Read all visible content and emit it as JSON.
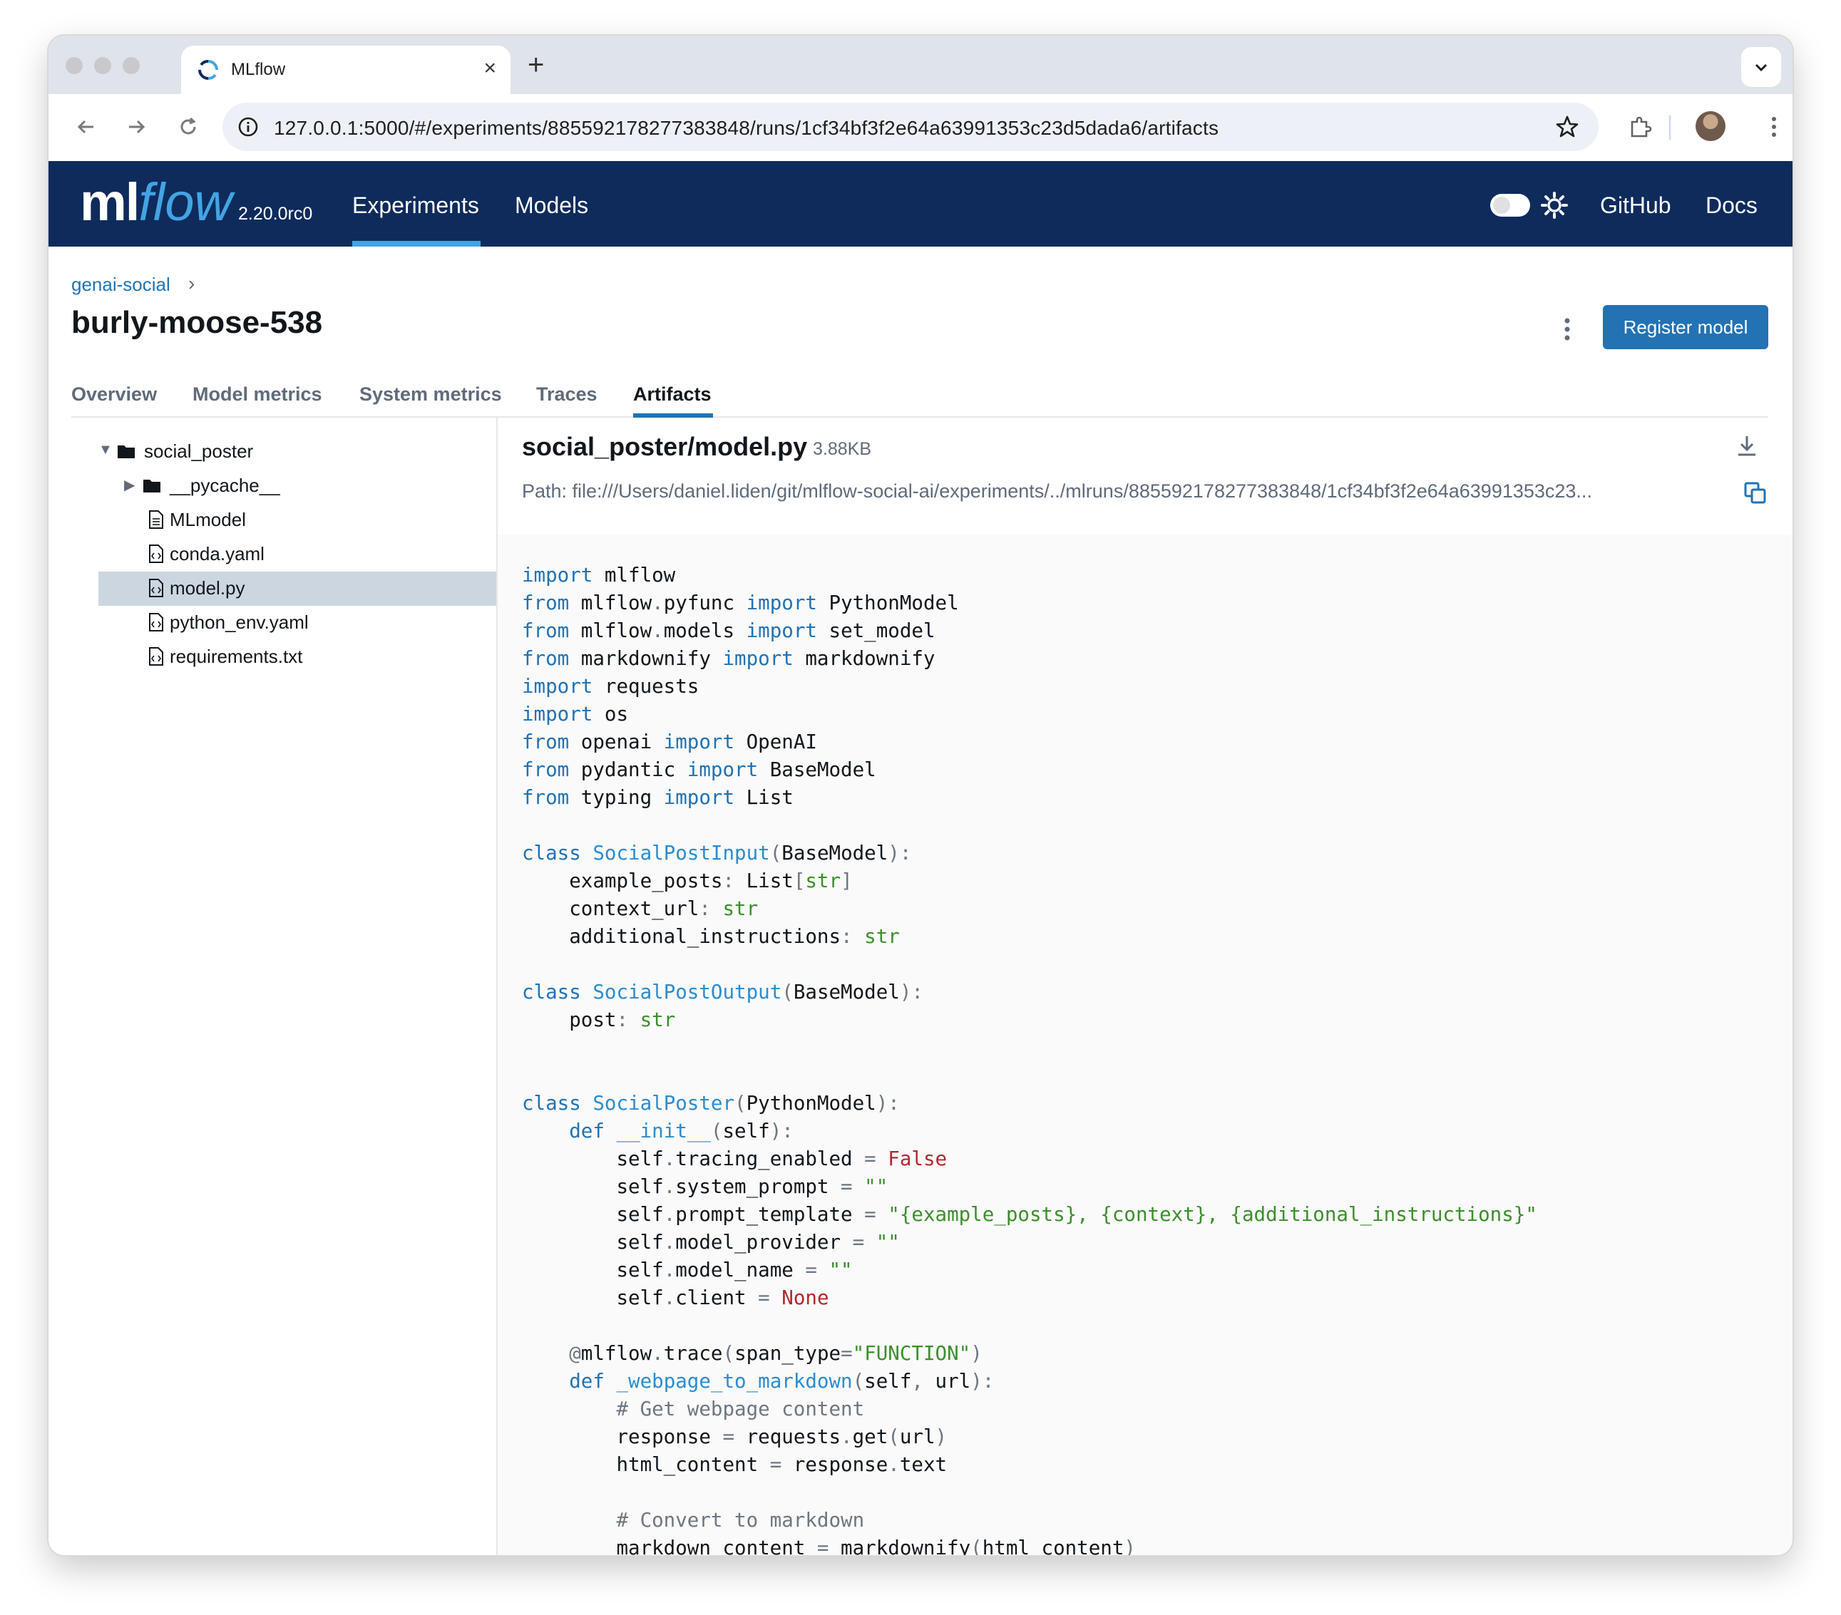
{
  "browser": {
    "tab_title": "MLflow",
    "tab_close": "×",
    "new_tab": "+",
    "url": "127.0.0.1:5000/#/experiments/885592178277383848/runs/1cf34bf3f2e64a63991353c23d5dada6/artifacts"
  },
  "header": {
    "logo_ml": "ml",
    "logo_flow": "flow",
    "version": "2.20.0rc0",
    "nav": [
      "Experiments",
      "Models"
    ],
    "right_links": [
      "GitHub",
      "Docs"
    ]
  },
  "run": {
    "breadcrumb": "genai-social",
    "breadcrumb_sep": "›",
    "title": "burly-moose-538",
    "register_label": "Register model",
    "tabs": [
      "Overview",
      "Model metrics",
      "System metrics",
      "Traces",
      "Artifacts"
    ],
    "active_tab": "Artifacts"
  },
  "tree": {
    "items": [
      {
        "label": "social_poster",
        "type": "folder",
        "caret": "▼"
      },
      {
        "label": "__pycache__",
        "type": "folder",
        "caret": "▶"
      },
      {
        "label": "MLmodel",
        "type": "file"
      },
      {
        "label": "conda.yaml",
        "type": "code-file"
      },
      {
        "label": "model.py",
        "type": "code-file",
        "selected": true
      },
      {
        "label": "python_env.yaml",
        "type": "code-file"
      },
      {
        "label": "requirements.txt",
        "type": "code-file"
      }
    ]
  },
  "file": {
    "name": "social_poster/model.py",
    "size": "3.88KB",
    "path": "Path: file:///Users/daniel.liden/git/mlflow-social-ai/experiments/../mlruns/885592178277383848/1cf34bf3f2e64a63991353c23..."
  },
  "code": [
    "import mlflow",
    "from mlflow.pyfunc import PythonModel",
    "from mlflow.models import set_model",
    "from markdownify import markdownify",
    "import requests",
    "import os",
    "from openai import OpenAI",
    "from pydantic import BaseModel",
    "from typing import List",
    "",
    "class SocialPostInput(BaseModel):",
    "    example_posts: List[str]",
    "    context_url: str",
    "    additional_instructions: str",
    "",
    "class SocialPostOutput(BaseModel):",
    "    post: str",
    "",
    "",
    "class SocialPoster(PythonModel):",
    "    def __init__(self):",
    "        self.tracing_enabled = False",
    "        self.system_prompt = \"\"",
    "        self.prompt_template = \"{example_posts}, {context}, {additional_instructions}\"",
    "        self.model_provider = \"\"",
    "        self.model_name = \"\"",
    "        self.client = None",
    "",
    "    @mlflow.trace(span_type=\"FUNCTION\")",
    "    def _webpage_to_markdown(self, url):",
    "        # Get webpage content",
    "        response = requests.get(url)",
    "        html_content = response.text",
    "",
    "        # Convert to markdown",
    "        markdown_content = markdownify(html_content)"
  ],
  "colors": {
    "header_bg": "#0e2b5c",
    "accent": "#2272b4",
    "keyword": "#2272b4",
    "string": "#3c8f2c",
    "constant": "#b2282b",
    "comment": "#6e7781"
  }
}
